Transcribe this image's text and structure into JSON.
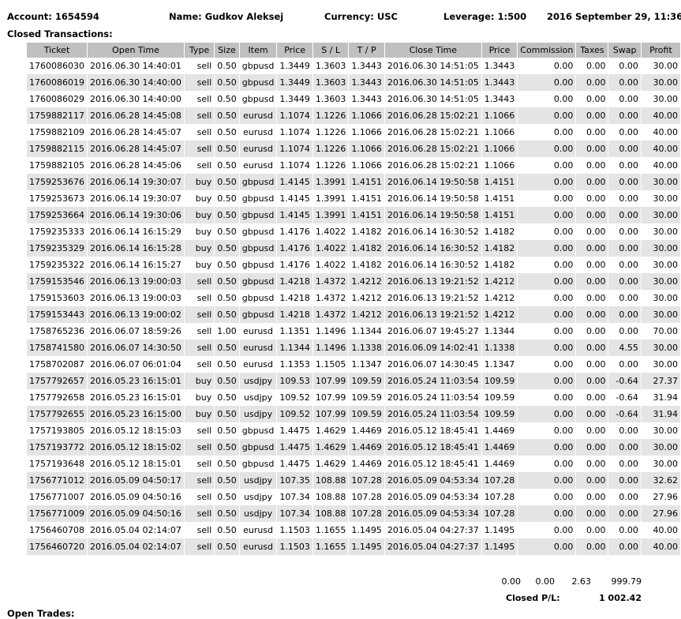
{
  "header": {
    "account": "Account: 1654594",
    "name": "Name: Gudkov Aleksej",
    "currency": "Currency: USC",
    "leverage": "Leverage: 1:500",
    "datetime": "2016 September 29, 11:36"
  },
  "section_title": "Closed Transactions:",
  "columns": [
    "Ticket",
    "Open Time",
    "Type",
    "Size",
    "Item",
    "Price",
    "S / L",
    "T / P",
    "Close Time",
    "Price",
    "Commission",
    "Taxes",
    "Swap",
    "Profit"
  ],
  "rows": [
    [
      "1760086030",
      "2016.06.30 14:40:01",
      "sell",
      "0.50",
      "gbpusd",
      "1.3449",
      "1.3603",
      "1.3443",
      "2016.06.30 14:51:05",
      "1.3443",
      "0.00",
      "0.00",
      "0.00",
      "30.00"
    ],
    [
      "1760086019",
      "2016.06.30 14:40:00",
      "sell",
      "0.50",
      "gbpusd",
      "1.3449",
      "1.3603",
      "1.3443",
      "2016.06.30 14:51:05",
      "1.3443",
      "0.00",
      "0.00",
      "0.00",
      "30.00"
    ],
    [
      "1760086029",
      "2016.06.30 14:40:00",
      "sell",
      "0.50",
      "gbpusd",
      "1.3449",
      "1.3603",
      "1.3443",
      "2016.06.30 14:51:05",
      "1.3443",
      "0.00",
      "0.00",
      "0.00",
      "30.00"
    ],
    [
      "1759882117",
      "2016.06.28 14:45:08",
      "sell",
      "0.50",
      "eurusd",
      "1.1074",
      "1.1226",
      "1.1066",
      "2016.06.28 15:02:21",
      "1.1066",
      "0.00",
      "0.00",
      "0.00",
      "40.00"
    ],
    [
      "1759882109",
      "2016.06.28 14:45:07",
      "sell",
      "0.50",
      "eurusd",
      "1.1074",
      "1.1226",
      "1.1066",
      "2016.06.28 15:02:21",
      "1.1066",
      "0.00",
      "0.00",
      "0.00",
      "40.00"
    ],
    [
      "1759882115",
      "2016.06.28 14:45:07",
      "sell",
      "0.50",
      "eurusd",
      "1.1074",
      "1.1226",
      "1.1066",
      "2016.06.28 15:02:21",
      "1.1066",
      "0.00",
      "0.00",
      "0.00",
      "40.00"
    ],
    [
      "1759882105",
      "2016.06.28 14:45:06",
      "sell",
      "0.50",
      "eurusd",
      "1.1074",
      "1.1226",
      "1.1066",
      "2016.06.28 15:02:21",
      "1.1066",
      "0.00",
      "0.00",
      "0.00",
      "40.00"
    ],
    [
      "1759253676",
      "2016.06.14 19:30:07",
      "buy",
      "0.50",
      "gbpusd",
      "1.4145",
      "1.3991",
      "1.4151",
      "2016.06.14 19:50:58",
      "1.4151",
      "0.00",
      "0.00",
      "0.00",
      "30.00"
    ],
    [
      "1759253673",
      "2016.06.14 19:30:07",
      "buy",
      "0.50",
      "gbpusd",
      "1.4145",
      "1.3991",
      "1.4151",
      "2016.06.14 19:50:58",
      "1.4151",
      "0.00",
      "0.00",
      "0.00",
      "30.00"
    ],
    [
      "1759253664",
      "2016.06.14 19:30:06",
      "buy",
      "0.50",
      "gbpusd",
      "1.4145",
      "1.3991",
      "1.4151",
      "2016.06.14 19:50:58",
      "1.4151",
      "0.00",
      "0.00",
      "0.00",
      "30.00"
    ],
    [
      "1759235333",
      "2016.06.14 16:15:29",
      "buy",
      "0.50",
      "gbpusd",
      "1.4176",
      "1.4022",
      "1.4182",
      "2016.06.14 16:30:52",
      "1.4182",
      "0.00",
      "0.00",
      "0.00",
      "30.00"
    ],
    [
      "1759235329",
      "2016.06.14 16:15:28",
      "buy",
      "0.50",
      "gbpusd",
      "1.4176",
      "1.4022",
      "1.4182",
      "2016.06.14 16:30:52",
      "1.4182",
      "0.00",
      "0.00",
      "0.00",
      "30.00"
    ],
    [
      "1759235322",
      "2016.06.14 16:15:27",
      "buy",
      "0.50",
      "gbpusd",
      "1.4176",
      "1.4022",
      "1.4182",
      "2016.06.14 16:30:52",
      "1.4182",
      "0.00",
      "0.00",
      "0.00",
      "30.00"
    ],
    [
      "1759153546",
      "2016.06.13 19:00:03",
      "sell",
      "0.50",
      "gbpusd",
      "1.4218",
      "1.4372",
      "1.4212",
      "2016.06.13 19:21:52",
      "1.4212",
      "0.00",
      "0.00",
      "0.00",
      "30.00"
    ],
    [
      "1759153603",
      "2016.06.13 19:00:03",
      "sell",
      "0.50",
      "gbpusd",
      "1.4218",
      "1.4372",
      "1.4212",
      "2016.06.13 19:21:52",
      "1.4212",
      "0.00",
      "0.00",
      "0.00",
      "30.00"
    ],
    [
      "1759153443",
      "2016.06.13 19:00:02",
      "sell",
      "0.50",
      "gbpusd",
      "1.4218",
      "1.4372",
      "1.4212",
      "2016.06.13 19:21:52",
      "1.4212",
      "0.00",
      "0.00",
      "0.00",
      "30.00"
    ],
    [
      "1758765236",
      "2016.06.07 18:59:26",
      "sell",
      "1.00",
      "eurusd",
      "1.1351",
      "1.1496",
      "1.1344",
      "2016.06.07 19:45:27",
      "1.1344",
      "0.00",
      "0.00",
      "0.00",
      "70.00"
    ],
    [
      "1758741580",
      "2016.06.07 14:30:50",
      "sell",
      "0.50",
      "eurusd",
      "1.1344",
      "1.1496",
      "1.1338",
      "2016.06.09 14:02:41",
      "1.1338",
      "0.00",
      "0.00",
      "4.55",
      "30.00"
    ],
    [
      "1758702087",
      "2016.06.07 06:01:04",
      "sell",
      "0.50",
      "eurusd",
      "1.1353",
      "1.1505",
      "1.1347",
      "2016.06.07 14:30:45",
      "1.1347",
      "0.00",
      "0.00",
      "0.00",
      "30.00"
    ],
    [
      "1757792657",
      "2016.05.23 16:15:01",
      "buy",
      "0.50",
      "usdjpy",
      "109.53",
      "107.99",
      "109.59",
      "2016.05.24 11:03:54",
      "109.59",
      "0.00",
      "0.00",
      "-0.64",
      "27.37"
    ],
    [
      "1757792658",
      "2016.05.23 16:15:01",
      "buy",
      "0.50",
      "usdjpy",
      "109.52",
      "107.99",
      "109.59",
      "2016.05.24 11:03:54",
      "109.59",
      "0.00",
      "0.00",
      "-0.64",
      "31.94"
    ],
    [
      "1757792655",
      "2016.05.23 16:15:00",
      "buy",
      "0.50",
      "usdjpy",
      "109.52",
      "107.99",
      "109.59",
      "2016.05.24 11:03:54",
      "109.59",
      "0.00",
      "0.00",
      "-0.64",
      "31.94"
    ],
    [
      "1757193805",
      "2016.05.12 18:15:03",
      "sell",
      "0.50",
      "gbpusd",
      "1.4475",
      "1.4629",
      "1.4469",
      "2016.05.12 18:45:41",
      "1.4469",
      "0.00",
      "0.00",
      "0.00",
      "30.00"
    ],
    [
      "1757193772",
      "2016.05.12 18:15:02",
      "sell",
      "0.50",
      "gbpusd",
      "1.4475",
      "1.4629",
      "1.4469",
      "2016.05.12 18:45:41",
      "1.4469",
      "0.00",
      "0.00",
      "0.00",
      "30.00"
    ],
    [
      "1757193648",
      "2016.05.12 18:15:01",
      "sell",
      "0.50",
      "gbpusd",
      "1.4475",
      "1.4629",
      "1.4469",
      "2016.05.12 18:45:41",
      "1.4469",
      "0.00",
      "0.00",
      "0.00",
      "30.00"
    ],
    [
      "1756771012",
      "2016.05.09 04:50:17",
      "sell",
      "0.50",
      "usdjpy",
      "107.35",
      "108.88",
      "107.28",
      "2016.05.09 04:53:34",
      "107.28",
      "0.00",
      "0.00",
      "0.00",
      "32.62"
    ],
    [
      "1756771007",
      "2016.05.09 04:50:16",
      "sell",
      "0.50",
      "usdjpy",
      "107.34",
      "108.88",
      "107.28",
      "2016.05.09 04:53:34",
      "107.28",
      "0.00",
      "0.00",
      "0.00",
      "27.96"
    ],
    [
      "1756771009",
      "2016.05.09 04:50:16",
      "sell",
      "0.50",
      "usdjpy",
      "107.34",
      "108.88",
      "107.28",
      "2016.05.09 04:53:34",
      "107.28",
      "0.00",
      "0.00",
      "0.00",
      "27.96"
    ],
    [
      "1756460708",
      "2016.05.04 02:14:07",
      "sell",
      "0.50",
      "eurusd",
      "1.1503",
      "1.1655",
      "1.1495",
      "2016.05.04 04:27:37",
      "1.1495",
      "0.00",
      "0.00",
      "0.00",
      "40.00"
    ],
    [
      "1756460720",
      "2016.05.04 02:14:07",
      "sell",
      "0.50",
      "eurusd",
      "1.1503",
      "1.1655",
      "1.1495",
      "2016.05.04 04:27:37",
      "1.1495",
      "0.00",
      "0.00",
      "0.00",
      "40.00"
    ]
  ],
  "totals": {
    "commission": "0.00",
    "taxes": "0.00",
    "swap": "2.63",
    "profit": "999.79"
  },
  "closed_pl": {
    "label": "Closed P/L:",
    "value": "1 002.42"
  },
  "next_section_partial": "Open Trades:"
}
